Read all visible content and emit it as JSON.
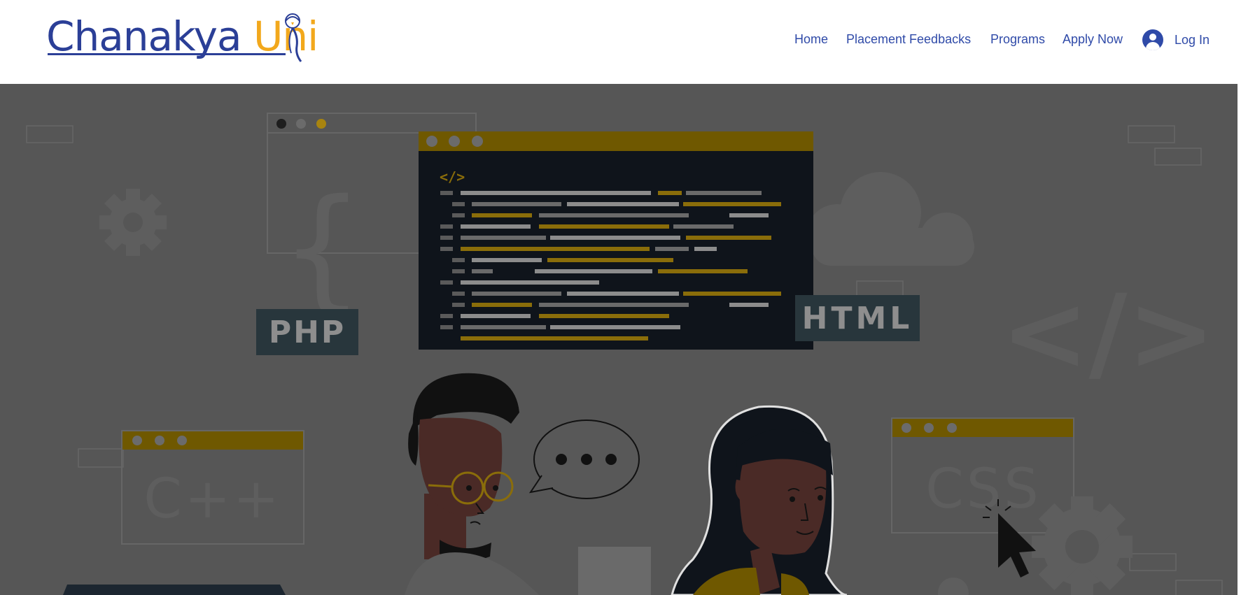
{
  "brand": {
    "name_part1": "Chanakya ",
    "name_part2": "Uni",
    "primary_color": "#2b3f97",
    "accent_color": "#f2a81c"
  },
  "nav": {
    "items": [
      {
        "label": "Home"
      },
      {
        "label": "Placement Feedbacks"
      },
      {
        "label": "Programs"
      },
      {
        "label": "Apply Now"
      }
    ],
    "login_label": "Log In",
    "login_icon": "user-avatar-icon"
  },
  "hero": {
    "overlay_color": "#565656",
    "code_tag": "</>",
    "badges": {
      "php": "PHP",
      "html": "HTML",
      "cpp": "C++",
      "css": "CSS"
    }
  }
}
